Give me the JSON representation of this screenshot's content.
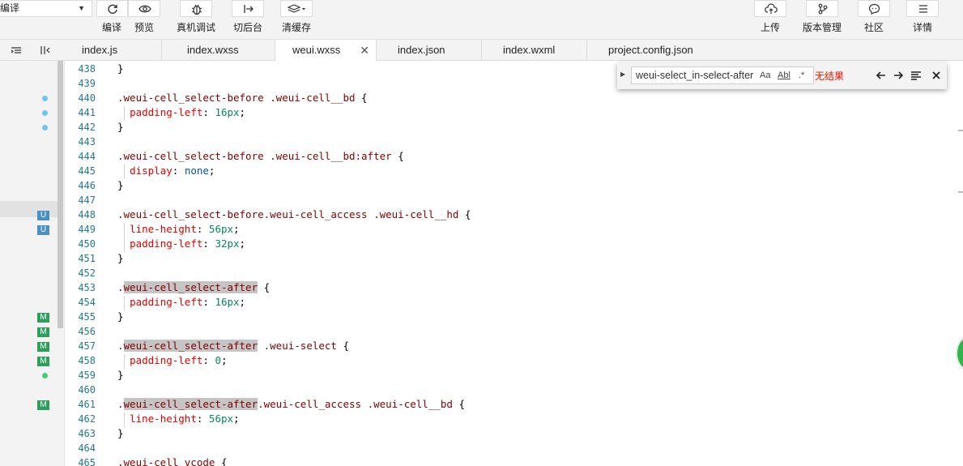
{
  "toolbar": {
    "mode_select": "编译",
    "left_buttons": [
      {
        "id": "compile",
        "label": "编译",
        "icon": "refresh-icon"
      },
      {
        "id": "preview",
        "label": "预览",
        "icon": "eye-icon"
      },
      {
        "id": "remote_debug",
        "label": "真机调试",
        "icon": "bug-icon"
      },
      {
        "id": "background",
        "label": "切后台",
        "icon": "switch-background-icon"
      },
      {
        "id": "clear_cache",
        "label": "清缓存",
        "icon": "layers-icon"
      }
    ],
    "right_buttons": [
      {
        "id": "upload",
        "label": "上传",
        "icon": "cloud-upload-icon"
      },
      {
        "id": "version",
        "label": "版本管理",
        "icon": "branch-icon"
      },
      {
        "id": "community",
        "label": "社区",
        "icon": "chat-icon"
      },
      {
        "id": "details",
        "label": "详情",
        "icon": "menu-icon"
      }
    ]
  },
  "tabs": {
    "items": [
      {
        "label": "index.js",
        "active": false
      },
      {
        "label": "index.wxss",
        "active": false
      },
      {
        "label": "weui.wxss",
        "active": true
      },
      {
        "label": "index.json",
        "active": false
      },
      {
        "label": "index.wxml",
        "active": false
      },
      {
        "label": "project.config.json",
        "active": false
      }
    ],
    "close_glyph": "✕"
  },
  "find": {
    "query": "weui-select_in-select-after",
    "match_case": "Aa",
    "whole_word": "Abl",
    "regex": ".*",
    "result": "无结果"
  },
  "editor": {
    "lines": [
      {
        "n": "438",
        "t": "}"
      },
      {
        "n": "439",
        "t": ""
      },
      {
        "n": "440",
        "t": ".weui-cell_select-before .weui-cell__bd {"
      },
      {
        "n": "441",
        "t": "  padding-left: 16px;"
      },
      {
        "n": "442",
        "t": "}"
      },
      {
        "n": "443",
        "t": ""
      },
      {
        "n": "444",
        "t": ".weui-cell_select-before .weui-cell__bd:after {"
      },
      {
        "n": "445",
        "t": "  display: none;"
      },
      {
        "n": "446",
        "t": "}"
      },
      {
        "n": "447",
        "t": ""
      },
      {
        "n": "448",
        "t": ".weui-cell_select-before.weui-cell_access .weui-cell__hd {"
      },
      {
        "n": "449",
        "t": "  line-height: 56px;"
      },
      {
        "n": "450",
        "t": "  padding-left: 32px;"
      },
      {
        "n": "451",
        "t": "}"
      },
      {
        "n": "452",
        "t": ""
      },
      {
        "n": "453",
        "t": ".weui-cell_select-after {"
      },
      {
        "n": "454",
        "t": "  padding-left: 16px;"
      },
      {
        "n": "455",
        "t": "}"
      },
      {
        "n": "456",
        "t": ""
      },
      {
        "n": "457",
        "t": ".weui-cell_select-after .weui-select {"
      },
      {
        "n": "458",
        "t": "  padding-left: 0;"
      },
      {
        "n": "459",
        "t": "}"
      },
      {
        "n": "460",
        "t": ""
      },
      {
        "n": "461",
        "t": ".weui-cell_select-after.weui-cell_access .weui-cell__bd {"
      },
      {
        "n": "462",
        "t": "  line-height: 56px;"
      },
      {
        "n": "463",
        "t": "}"
      },
      {
        "n": "464",
        "t": ""
      },
      {
        "n": "465",
        "t": ".weui-cell_vcode {"
      }
    ],
    "highlight_term": "weui-cell_select-after"
  },
  "gutter_markers": [
    {
      "line": "440",
      "kind": "dot",
      "color": "#6ec6f0"
    },
    {
      "line": "441",
      "kind": "dot",
      "color": "#6ec6f0"
    },
    {
      "line": "442",
      "kind": "dot",
      "color": "#6ec6f0"
    },
    {
      "line": "448",
      "kind": "badge",
      "text": "U",
      "color": "#4a90c2"
    },
    {
      "line": "449",
      "kind": "badge",
      "text": "U",
      "color": "#4a90c2"
    },
    {
      "line": "455",
      "kind": "badge",
      "text": "M",
      "color": "#2e9e5b"
    },
    {
      "line": "456",
      "kind": "badge",
      "text": "M",
      "color": "#2e9e5b"
    },
    {
      "line": "457",
      "kind": "badge",
      "text": "M",
      "color": "#2e9e5b"
    },
    {
      "line": "458",
      "kind": "badge",
      "text": "M",
      "color": "#2e9e5b"
    },
    {
      "line": "459",
      "kind": "dot",
      "color": "#3ecf7a"
    },
    {
      "line": "461",
      "kind": "badge",
      "text": "M",
      "color": "#2e9e5b"
    }
  ],
  "colors": {
    "selector": "#800000",
    "property": "#e50000",
    "number": "#098658",
    "keyword": "#0451a5",
    "line_number": "#237893",
    "find_no_result": "#e51400"
  }
}
